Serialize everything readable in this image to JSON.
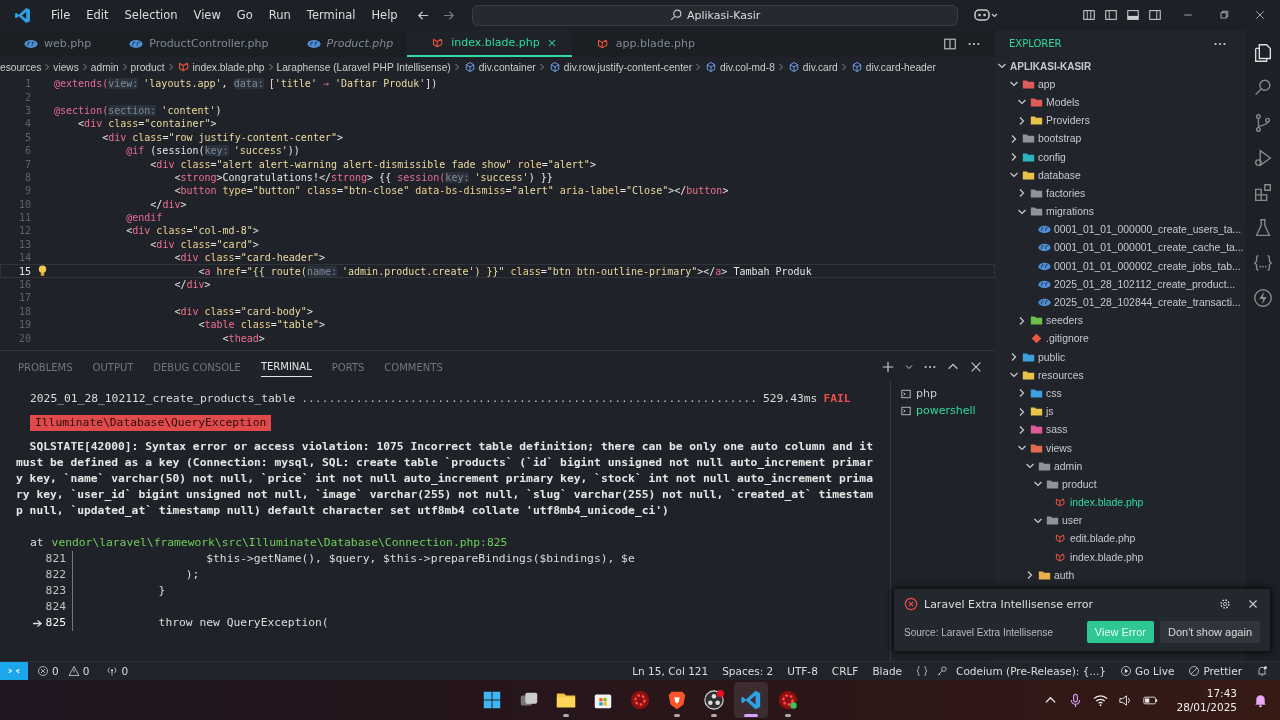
{
  "title_bar": {
    "menu": [
      "File",
      "Edit",
      "Selection",
      "View",
      "Go",
      "Run",
      "Terminal",
      "Help"
    ],
    "search": "Aplikasi-Kasir"
  },
  "editor_tabs": [
    {
      "label": "web.php",
      "kind": "php",
      "preview": false,
      "selected": false
    },
    {
      "label": "ProductController.php",
      "kind": "php",
      "preview": false,
      "selected": false
    },
    {
      "label": "Product.php",
      "kind": "php",
      "preview": true,
      "selected": false
    },
    {
      "label": "index.blade.php",
      "kind": "blade",
      "preview": false,
      "selected": true
    },
    {
      "label": "app.blade.php",
      "kind": "blade",
      "preview": false,
      "selected": false
    }
  ],
  "breadcrumbs": [
    {
      "label": "esources",
      "kind": "text"
    },
    {
      "label": "views",
      "kind": "text"
    },
    {
      "label": "admin",
      "kind": "text"
    },
    {
      "label": "product",
      "kind": "text"
    },
    {
      "label": "index.blade.php",
      "kind": "blade"
    },
    {
      "label": "Laraphense (Laravel PHP Intellisense)",
      "kind": "text"
    },
    {
      "label": "div.container",
      "kind": "symbol"
    },
    {
      "label": "div.row.justify-content-center",
      "kind": "symbol"
    },
    {
      "label": "div.col-md-8",
      "kind": "symbol"
    },
    {
      "label": "div.card",
      "kind": "symbol"
    },
    {
      "label": "div.card-header",
      "kind": "symbol"
    }
  ],
  "code_lines": [
    {
      "number": "1",
      "current": false,
      "tokens": [
        {
          "text": "@extends(",
          "kind": "dir"
        },
        {
          "text": "view:",
          "kind": "hint"
        },
        {
          "text": "'layouts.app'",
          "kind": "str"
        },
        {
          "text": ", ",
          "kind": "plain"
        },
        {
          "text": "data:",
          "kind": "hint"
        },
        {
          "text": "[",
          "kind": "plain"
        },
        {
          "text": "'title'",
          "kind": "str"
        },
        {
          "text": " ⇒ ",
          "kind": "dir"
        },
        {
          "text": "'Daftar Produk'",
          "kind": "str"
        },
        {
          "text": "])",
          "kind": "plain"
        }
      ]
    },
    {
      "number": "2",
      "current": false
    },
    {
      "number": "3",
      "current": false,
      "tokens": [
        {
          "text": "@section(",
          "kind": "dir"
        },
        {
          "text": "section:",
          "kind": "hint"
        },
        {
          "text": "'content'",
          "kind": "str"
        },
        {
          "text": ")",
          "kind": "plain"
        }
      ]
    },
    {
      "number": "4",
      "current": false,
      "tokens": [
        {
          "text": "    <",
          "kind": "plain"
        },
        {
          "text": "div",
          "kind": "tag"
        },
        {
          "text": " class",
          "kind": "attr"
        },
        {
          "text": "=",
          "kind": "plain"
        },
        {
          "text": "\"container\"",
          "kind": "str"
        },
        {
          "text": ">",
          "kind": "plain"
        }
      ]
    },
    {
      "number": "5",
      "current": false,
      "tokens": [
        {
          "text": "        <",
          "kind": "plain"
        },
        {
          "text": "div",
          "kind": "tag"
        },
        {
          "text": " class",
          "kind": "attr"
        },
        {
          "text": "=",
          "kind": "plain"
        },
        {
          "text": "\"row justify-content-center\"",
          "kind": "str"
        },
        {
          "text": ">",
          "kind": "plain"
        }
      ]
    },
    {
      "number": "6",
      "current": false,
      "tokens": [
        {
          "text": "            @if",
          "kind": "dir"
        },
        {
          "text": " (session(",
          "kind": "plain"
        },
        {
          "text": "key:",
          "kind": "hint"
        },
        {
          "text": "'success'",
          "kind": "str"
        },
        {
          "text": "))",
          "kind": "plain"
        }
      ]
    },
    {
      "number": "7",
      "current": false,
      "tokens": [
        {
          "text": "                <",
          "kind": "plain"
        },
        {
          "text": "div",
          "kind": "tag"
        },
        {
          "text": " class",
          "kind": "attr"
        },
        {
          "text": "=",
          "kind": "plain"
        },
        {
          "text": "\"alert alert-warning alert-dismissible fade show\"",
          "kind": "str"
        },
        {
          "text": " role",
          "kind": "attr"
        },
        {
          "text": "=",
          "kind": "plain"
        },
        {
          "text": "\"alert\"",
          "kind": "str"
        },
        {
          "text": ">",
          "kind": "plain"
        }
      ]
    },
    {
      "number": "8",
      "current": false,
      "tokens": [
        {
          "text": "                    <",
          "kind": "plain"
        },
        {
          "text": "strong",
          "kind": "tag"
        },
        {
          "text": ">Congratulations!</",
          "kind": "plain"
        },
        {
          "text": "strong",
          "kind": "tag"
        },
        {
          "text": "> {{ ",
          "kind": "plain"
        },
        {
          "text": "session(",
          "kind": "dir"
        },
        {
          "text": "key:",
          "kind": "hint"
        },
        {
          "text": "'success'",
          "kind": "str"
        },
        {
          "text": ") }}",
          "kind": "plain"
        }
      ]
    },
    {
      "number": "9",
      "current": false,
      "tokens": [
        {
          "text": "                    <",
          "kind": "plain"
        },
        {
          "text": "button",
          "kind": "tag"
        },
        {
          "text": " type",
          "kind": "attr"
        },
        {
          "text": "=",
          "kind": "plain"
        },
        {
          "text": "\"button\"",
          "kind": "str"
        },
        {
          "text": " class",
          "kind": "attr"
        },
        {
          "text": "=",
          "kind": "plain"
        },
        {
          "text": "\"btn-close\"",
          "kind": "str"
        },
        {
          "text": " data-bs-dismiss",
          "kind": "attr"
        },
        {
          "text": "=",
          "kind": "plain"
        },
        {
          "text": "\"alert\"",
          "kind": "str"
        },
        {
          "text": " aria-label",
          "kind": "attr"
        },
        {
          "text": "=",
          "kind": "plain"
        },
        {
          "text": "\"Close\"",
          "kind": "str"
        },
        {
          "text": "></",
          "kind": "plain"
        },
        {
          "text": "button",
          "kind": "tag"
        },
        {
          "text": ">",
          "kind": "plain"
        }
      ]
    },
    {
      "number": "10",
      "current": false,
      "tokens": [
        {
          "text": "                </",
          "kind": "plain"
        },
        {
          "text": "div",
          "kind": "tag"
        },
        {
          "text": ">",
          "kind": "plain"
        }
      ]
    },
    {
      "number": "11",
      "current": false,
      "tokens": [
        {
          "text": "            @endif",
          "kind": "dir"
        }
      ]
    },
    {
      "number": "12",
      "current": false,
      "tokens": [
        {
          "text": "            <",
          "kind": "plain"
        },
        {
          "text": "div",
          "kind": "tag"
        },
        {
          "text": " class",
          "kind": "attr"
        },
        {
          "text": "=",
          "kind": "plain"
        },
        {
          "text": "\"col-md-8\"",
          "kind": "str"
        },
        {
          "text": ">",
          "kind": "plain"
        }
      ]
    },
    {
      "number": "13",
      "current": false,
      "tokens": [
        {
          "text": "                <",
          "kind": "plain"
        },
        {
          "text": "div",
          "kind": "tag"
        },
        {
          "text": " class",
          "kind": "attr"
        },
        {
          "text": "=",
          "kind": "plain"
        },
        {
          "text": "\"card\"",
          "kind": "str"
        },
        {
          "text": ">",
          "kind": "plain"
        }
      ]
    },
    {
      "number": "14",
      "current": false,
      "tokens": [
        {
          "text": "                    <",
          "kind": "plain"
        },
        {
          "text": "div",
          "kind": "tag"
        },
        {
          "text": " class",
          "kind": "attr"
        },
        {
          "text": "=",
          "kind": "plain"
        },
        {
          "text": "\"card-header\"",
          "kind": "str"
        },
        {
          "text": ">",
          "kind": "plain"
        }
      ]
    },
    {
      "number": "15",
      "current": true,
      "tokens": [
        {
          "text": "                        <",
          "kind": "plain"
        },
        {
          "text": "a",
          "kind": "tag"
        },
        {
          "text": " href",
          "kind": "attr"
        },
        {
          "text": "=",
          "kind": "plain"
        },
        {
          "text": "\"{{ route(",
          "kind": "str"
        },
        {
          "text": "name:",
          "kind": "hint"
        },
        {
          "text": "'admin.product.create') }}\"",
          "kind": "str"
        },
        {
          "text": " class",
          "kind": "attr"
        },
        {
          "text": "=",
          "kind": "plain"
        },
        {
          "text": "\"btn btn-outline-primary\"",
          "kind": "str"
        },
        {
          "text": "></",
          "kind": "plain"
        },
        {
          "text": "a",
          "kind": "tag"
        },
        {
          "text": "> Tambah Produk",
          "kind": "plain"
        }
      ]
    },
    {
      "number": "16",
      "current": false,
      "tokens": [
        {
          "text": "                    </",
          "kind": "plain"
        },
        {
          "text": "div",
          "kind": "tag"
        },
        {
          "text": ">",
          "kind": "plain"
        }
      ]
    },
    {
      "number": "17",
      "current": false
    },
    {
      "number": "18",
      "current": false,
      "tokens": [
        {
          "text": "                    <",
          "kind": "plain"
        },
        {
          "text": "div",
          "kind": "tag"
        },
        {
          "text": " class",
          "kind": "attr"
        },
        {
          "text": "=",
          "kind": "plain"
        },
        {
          "text": "\"card-body\"",
          "kind": "str"
        },
        {
          "text": ">",
          "kind": "plain"
        }
      ]
    },
    {
      "number": "19",
      "current": false,
      "tokens": [
        {
          "text": "                        <",
          "kind": "plain"
        },
        {
          "text": "table",
          "kind": "tag"
        },
        {
          "text": " class",
          "kind": "attr"
        },
        {
          "text": "=",
          "kind": "plain"
        },
        {
          "text": "\"table\"",
          "kind": "str"
        },
        {
          "text": ">",
          "kind": "plain"
        }
      ]
    },
    {
      "number": "20",
      "current": false,
      "tokens": [
        {
          "text": "                            <",
          "kind": "plain"
        },
        {
          "text": "thead",
          "kind": "tag"
        },
        {
          "text": ">",
          "kind": "plain"
        }
      ]
    }
  ],
  "panel_tabs": [
    {
      "label": "PROBLEMS",
      "selected": false
    },
    {
      "label": "OUTPUT",
      "selected": false
    },
    {
      "label": "DEBUG CONSOLE",
      "selected": false
    },
    {
      "label": "TERMINAL",
      "selected": true
    },
    {
      "label": "PORTS",
      "selected": false
    },
    {
      "label": "COMMENTS",
      "selected": false
    }
  ],
  "terminal": {
    "migration": {
      "name": "2025_01_28_102112_create_products_table",
      "dots": "...................................................................",
      "time": "529.43ms",
      "status": "FAIL"
    },
    "exception": "Illuminate\\Database\\QueryException",
    "message": "SQLSTATE[42000]: Syntax error or access violation: 1075 Incorrect table definition; there can be only one auto column and it must be defined as a key (Connection: mysql, SQL: create table `products` (`id` bigint unsigned not null auto_increment primary key, `name` varchar(50) not null, `price` int not null auto_increment primary key, `stock` int not null auto_increment primary key, `user_id` bigint unsigned not null, `image` varchar(255) not null, `slug` varchar(255) not null, `created_at` timestamp null, `updated_at` timestamp null) default character set utf8mb4 collate 'utf8mb4_unicode_ci')",
    "at": "at",
    "path": "vendor\\laravel\\framework\\src\\Illuminate\\Database\\Connection.php:825",
    "frames": [
      {
        "number": "821",
        "code": "                   $this->getName(), $query, $this->prepareBindings($bindings), $e",
        "current": false
      },
      {
        "number": "822",
        "code": "                );",
        "current": false
      },
      {
        "number": "823",
        "code": "            }",
        "current": false
      },
      {
        "number": "824",
        "current": false
      },
      {
        "number": "825",
        "code": "            throw new QueryException(",
        "current": true
      }
    ]
  },
  "terminal_list": [
    {
      "label": "php",
      "selected": false
    },
    {
      "label": "powershell",
      "selected": true
    }
  ],
  "explorer": {
    "title": "EXPLORER",
    "root": {
      "label": "APLIKASI-KASIR",
      "expanded": true
    },
    "tree": [
      {
        "label": "app",
        "kind": "folder",
        "color": "#e05a5a",
        "expanded": true,
        "selected": false,
        "children": [
          {
            "label": "Models",
            "kind": "folder",
            "color": "#e05a5a",
            "expanded": true,
            "selected": false
          },
          {
            "label": "Providers",
            "kind": "folder",
            "color": "#e8c34a",
            "expanded": false,
            "selected": false
          }
        ]
      },
      {
        "label": "bootstrap",
        "kind": "folder",
        "color": "#8c939c",
        "expanded": false,
        "selected": false
      },
      {
        "label": "config",
        "kind": "folder",
        "color": "#2bb3c0",
        "expanded": false,
        "selected": false
      },
      {
        "label": "database",
        "kind": "folder",
        "color": "#e8c34a",
        "expanded": true,
        "selected": false,
        "children": [
          {
            "label": "factories",
            "kind": "folder",
            "color": "#8c939c",
            "expanded": false,
            "selected": false
          },
          {
            "label": "migrations",
            "kind": "folder",
            "color": "#8c939c",
            "expanded": true,
            "selected": false,
            "children": [
              {
                "label": "0001_01_01_000000_create_users_ta...",
                "kind": "php",
                "selected": false
              },
              {
                "label": "0001_01_01_000001_create_cache_ta...",
                "kind": "php",
                "selected": false
              },
              {
                "label": "0001_01_01_000002_create_jobs_tab...",
                "kind": "php",
                "selected": false
              },
              {
                "label": "2025_01_28_102112_create_product...",
                "kind": "php",
                "selected": false
              },
              {
                "label": "2025_01_28_102844_create_transacti...",
                "kind": "php",
                "selected": false
              }
            ]
          },
          {
            "label": "seeders",
            "kind": "folder",
            "color": "#6cc04a",
            "expanded": false,
            "selected": false
          },
          {
            "label": ".gitignore",
            "kind": "git",
            "selected": false
          }
        ]
      },
      {
        "label": "public",
        "kind": "folder",
        "color": "#3aa0e0",
        "expanded": false,
        "selected": false
      },
      {
        "label": "resources",
        "kind": "folder",
        "color": "#e8c34a",
        "expanded": true,
        "selected": false,
        "children": [
          {
            "label": "css",
            "kind": "folder",
            "color": "#3aa0e0",
            "expanded": false,
            "selected": false
          },
          {
            "label": "js",
            "kind": "folder",
            "color": "#e8c34a",
            "expanded": false,
            "selected": false
          },
          {
            "label": "sass",
            "kind": "folder",
            "color": "#e05a9a",
            "expanded": false,
            "selected": false
          },
          {
            "label": "views",
            "kind": "folder",
            "color": "#e06a4a",
            "expanded": true,
            "selected": false,
            "children": [
              {
                "label": "admin",
                "kind": "folder",
                "color": "#8c939c",
                "expanded": true,
                "selected": false,
                "children": [
                  {
                    "label": "product",
                    "kind": "folder",
                    "color": "#8c939c",
                    "expanded": true,
                    "selected": false,
                    "children": [
                      {
                        "label": "index.blade.php",
                        "kind": "blade",
                        "selected": true
                      }
                    ]
                  },
                  {
                    "label": "user",
                    "kind": "folder",
                    "color": "#8c939c",
                    "expanded": true,
                    "selected": false,
                    "children": [
                      {
                        "label": "edit.blade.php",
                        "kind": "blade",
                        "selected": false
                      },
                      {
                        "label": "index.blade.php",
                        "kind": "blade",
                        "selected": false
                      }
                    ]
                  }
                ]
              },
              {
                "label": "auth",
                "kind": "folder",
                "color": "#e8b04a",
                "expanded": false,
                "selected": false
              }
            ]
          }
        ]
      }
    ]
  },
  "notification": {
    "title": "Laravel Extra Intellisense error",
    "source": "Source: Laravel Extra Intellisense",
    "buttons": [
      {
        "label": "View Error",
        "kind": "primary"
      },
      {
        "label": "Don't show again",
        "kind": "secondary"
      }
    ]
  },
  "status_bar": {
    "errors": "0",
    "warnings": "0",
    "ports": "0",
    "position": "Ln 15, Col 121",
    "spaces": "Spaces: 2",
    "encoding": "UTF-8",
    "eol": "CRLF",
    "language": "Blade",
    "codeium": "Codeium (Pre-Release): {...}",
    "go_live": "Go Live",
    "prettier": "Prettier"
  },
  "taskbar": {
    "apps": [
      {
        "kind": "start",
        "running": false,
        "active": false
      },
      {
        "kind": "task-view",
        "running": false,
        "active": false
      },
      {
        "kind": "files",
        "running": true,
        "active": false
      },
      {
        "kind": "store",
        "running": false,
        "active": false
      },
      {
        "kind": "red-gear",
        "running": false,
        "active": false
      },
      {
        "kind": "lion",
        "running": true,
        "active": false
      },
      {
        "kind": "obs",
        "running": true,
        "active": false
      },
      {
        "kind": "vscode",
        "running": true,
        "active": true
      },
      {
        "kind": "red-gear",
        "running": true,
        "active": false
      }
    ],
    "time": "17:43",
    "date": "28/01/2025"
  }
}
